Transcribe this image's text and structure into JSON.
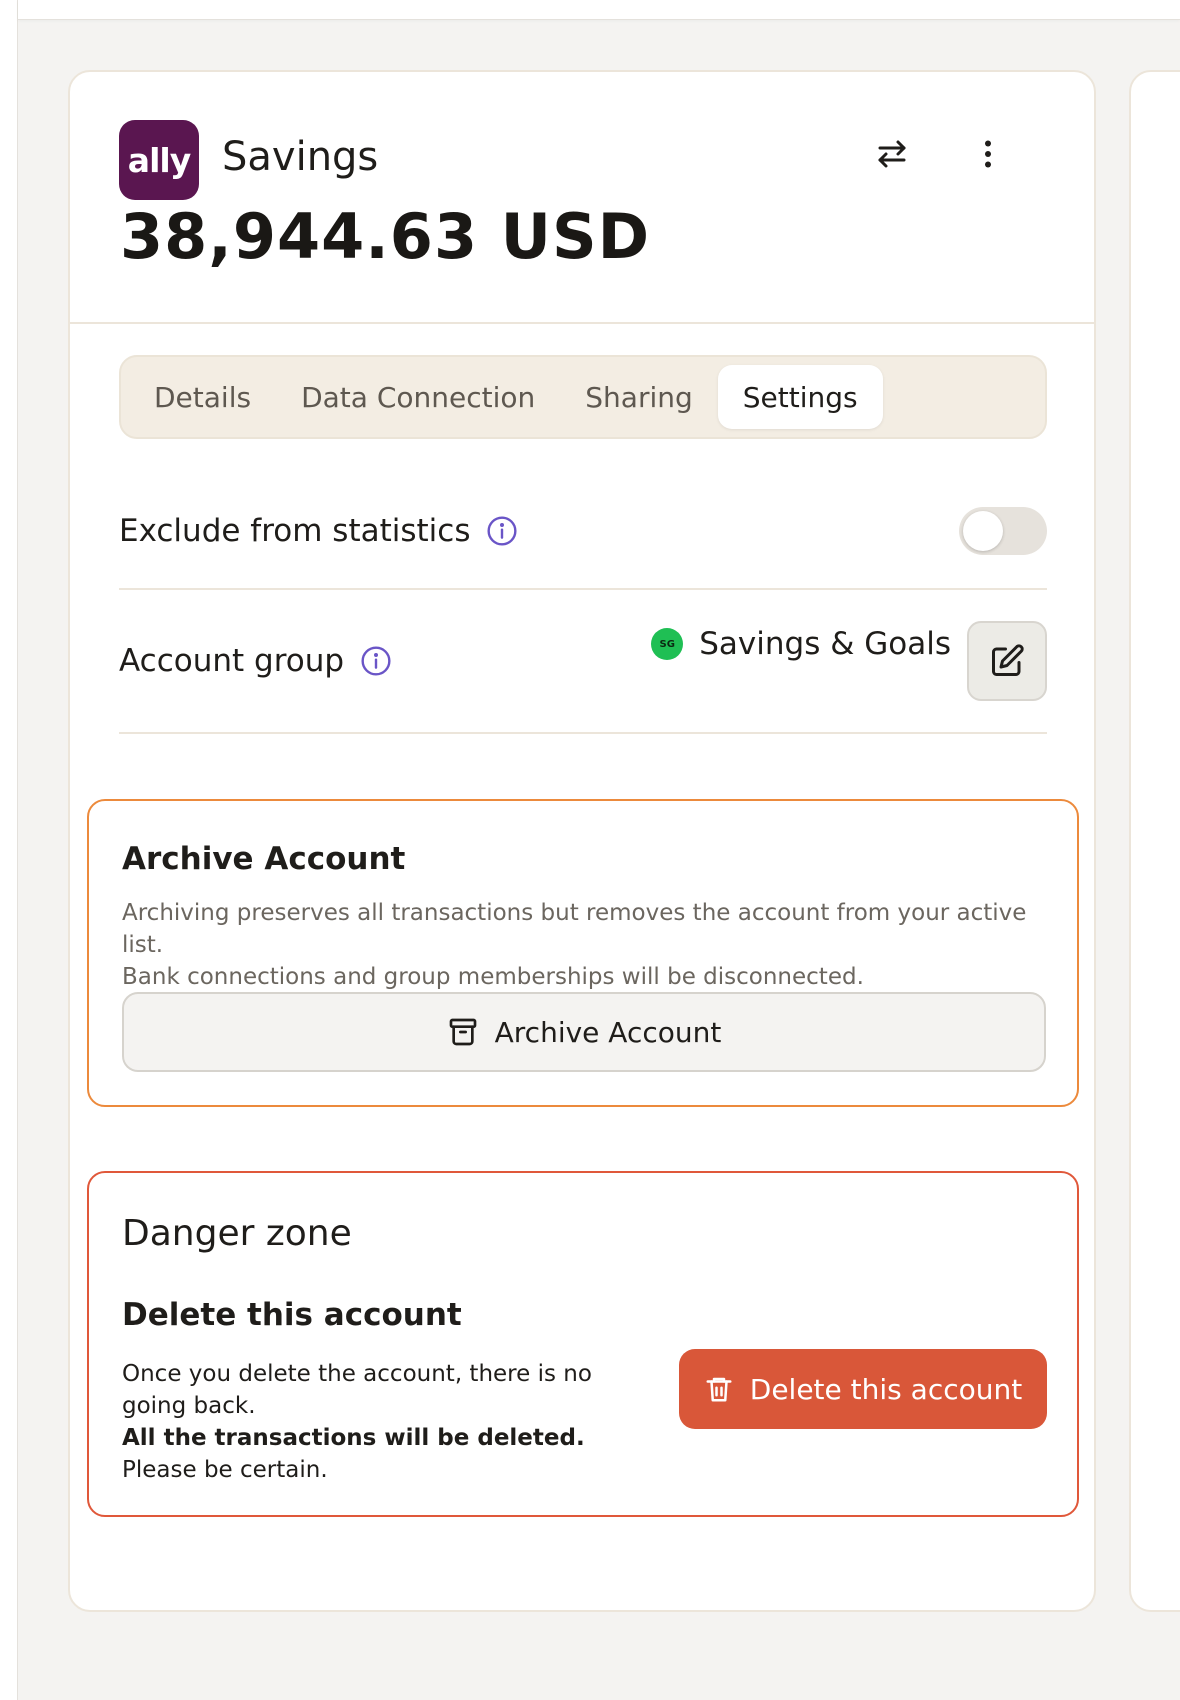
{
  "account": {
    "logo_text": "ally",
    "name": "Savings",
    "balance": "38,944.63 USD"
  },
  "header_actions": {
    "transfer_icon": "swap-arrows-icon",
    "more_icon": "vertical-dots-icon"
  },
  "tabs": [
    {
      "label": "Details",
      "active": false
    },
    {
      "label": "Data Connection",
      "active": false
    },
    {
      "label": "Sharing",
      "active": false
    },
    {
      "label": "Settings",
      "active": true
    }
  ],
  "settings": {
    "exclude_label": "Exclude from statistics",
    "exclude_enabled": false,
    "group_label": "Account group",
    "group_badge": "SG",
    "group_name": "Savings & Goals"
  },
  "archive": {
    "title": "Archive Account",
    "desc_line1": "Archiving preserves all transactions but removes the account from your active list.",
    "desc_line2": "Bank connections and group memberships will be disconnected.",
    "button_label": "Archive Account"
  },
  "danger": {
    "title": "Danger zone",
    "delete_title": "Delete this account",
    "desc_part1": "Once you delete the account, there is no going back.",
    "desc_bold": "All the transactions will be deleted.",
    "desc_part2": "Please be certain.",
    "button_label": "Delete this account"
  },
  "colors": {
    "brand_logo": "#5a1650",
    "info_icon": "#6a55c7",
    "group_badge": "#1fbf54",
    "archive_border": "#ec8a3c",
    "danger_border": "#e0583a",
    "danger_button": "#d95739"
  }
}
